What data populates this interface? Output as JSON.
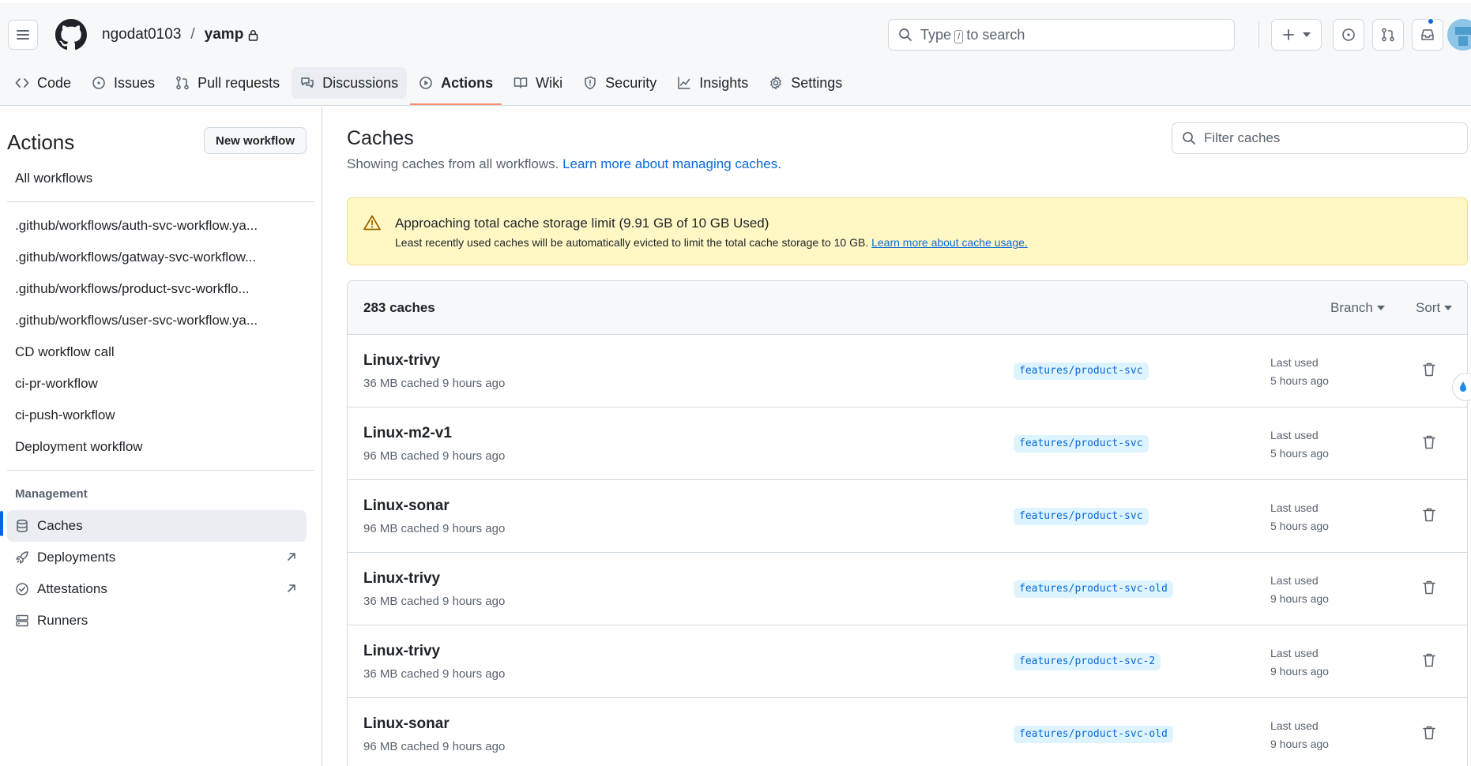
{
  "header": {
    "owner": "ngodat0103",
    "separator": "/",
    "repo": "yamp",
    "search_prefix": "Type",
    "search_key": "/",
    "search_suffix": "to search"
  },
  "repo_nav": {
    "tabs": [
      {
        "label": "Code",
        "icon": "code-icon"
      },
      {
        "label": "Issues",
        "icon": "issue-icon"
      },
      {
        "label": "Pull requests",
        "icon": "pull-request-icon"
      },
      {
        "label": "Discussions",
        "icon": "discussion-icon"
      },
      {
        "label": "Actions",
        "icon": "play-icon"
      },
      {
        "label": "Wiki",
        "icon": "book-icon"
      },
      {
        "label": "Security",
        "icon": "shield-icon"
      },
      {
        "label": "Insights",
        "icon": "graph-icon"
      },
      {
        "label": "Settings",
        "icon": "gear-icon"
      }
    ],
    "selected": "Actions"
  },
  "sidebar": {
    "title": "Actions",
    "new_workflow_label": "New workflow",
    "all_workflows": "All workflows",
    "workflows": [
      ".github/workflows/auth-svc-workflow.ya...",
      ".github/workflows/gatway-svc-workflow...",
      ".github/workflows/product-svc-workflo...",
      ".github/workflows/user-svc-workflow.ya...",
      "CD workflow call",
      "ci-pr-workflow",
      "ci-push-workflow",
      "Deployment workflow"
    ],
    "management_heading": "Management",
    "management": [
      {
        "label": "Caches",
        "icon": "database-icon",
        "active": true
      },
      {
        "label": "Deployments",
        "icon": "rocket-icon",
        "external": true
      },
      {
        "label": "Attestations",
        "icon": "verified-icon",
        "external": true
      },
      {
        "label": "Runners",
        "icon": "server-icon"
      }
    ]
  },
  "main": {
    "title": "Caches",
    "subtitle": "Showing caches from all workflows.",
    "learn_more": "Learn more about managing caches.",
    "filter_placeholder": "Filter caches",
    "banner": {
      "title": "Approaching total cache storage limit (9.91 GB of 10 GB Used)",
      "text": "Least recently used caches will be automatically evicted to limit the total cache storage to 10 GB.",
      "link": "Learn more about cache usage."
    },
    "table": {
      "count_label": "283 caches",
      "branch_label": "Branch",
      "sort_label": "Sort",
      "rows": [
        {
          "name": "Linux-trivy",
          "meta": "36 MB cached 9 hours ago",
          "branch": "features/product-svc",
          "last_used_label": "Last used",
          "last_used": "5 hours ago"
        },
        {
          "name": "Linux-m2-v1",
          "meta": "96 MB cached 9 hours ago",
          "branch": "features/product-svc",
          "last_used_label": "Last used",
          "last_used": "5 hours ago"
        },
        {
          "name": "Linux-sonar",
          "meta": "96 MB cached 9 hours ago",
          "branch": "features/product-svc",
          "last_used_label": "Last used",
          "last_used": "5 hours ago"
        },
        {
          "name": "Linux-trivy",
          "meta": "36 MB cached 9 hours ago",
          "branch": "features/product-svc-old",
          "last_used_label": "Last used",
          "last_used": "9 hours ago"
        },
        {
          "name": "Linux-trivy",
          "meta": "36 MB cached 9 hours ago",
          "branch": "features/product-svc-2",
          "last_used_label": "Last used",
          "last_used": "9 hours ago"
        },
        {
          "name": "Linux-sonar",
          "meta": "96 MB cached 9 hours ago",
          "branch": "features/product-svc-old",
          "last_used_label": "Last used",
          "last_used": "9 hours ago"
        }
      ]
    }
  },
  "colors": {
    "accent": "#0969da",
    "tab_underline": "#fd8c73",
    "banner_bg": "#fff8c5",
    "branch_bg": "#ddf4ff"
  }
}
